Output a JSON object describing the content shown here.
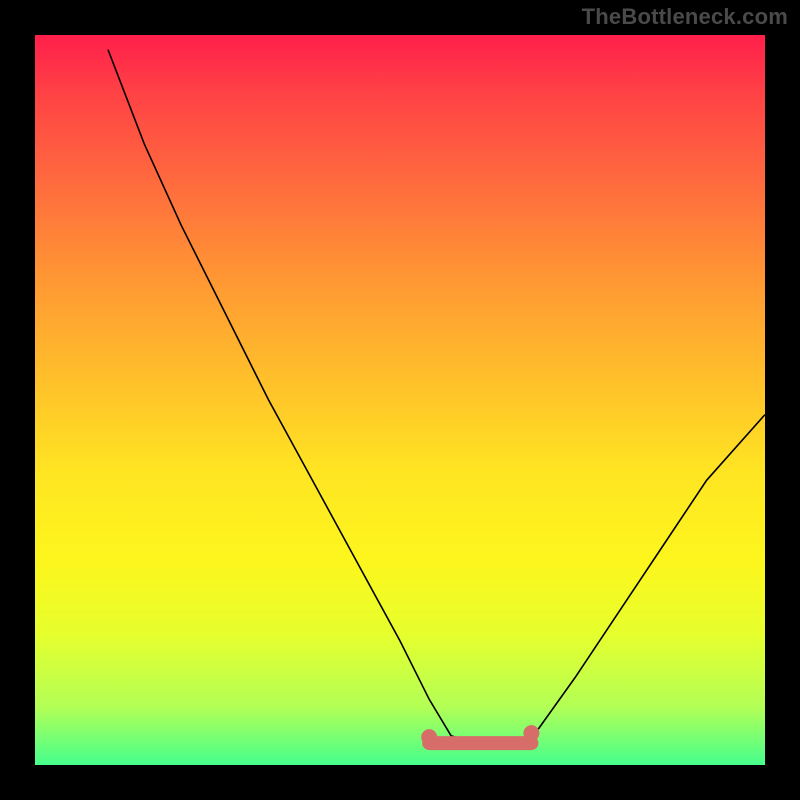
{
  "watermark": "TheBottleneck.com",
  "chart_data": {
    "type": "line",
    "title": "",
    "xlabel": "",
    "ylabel": "",
    "xlim": [
      0,
      100
    ],
    "ylim": [
      0,
      100
    ],
    "description": "V-shaped bottleneck curve over red-to-green vertical gradient; minimum plateau near x≈55–67 at y≈3, left arm rises to ~98 at x≈10, right arm rises to ~48 at x=100.",
    "series": [
      {
        "name": "bottleneck-curve",
        "x": [
          10,
          15,
          20,
          26,
          32,
          38,
          44,
          50,
          54,
          57,
          60,
          63,
          66,
          69,
          74,
          80,
          86,
          92,
          100
        ],
        "y": [
          98,
          85,
          74,
          62,
          50,
          39,
          28,
          17,
          9,
          4,
          3,
          3,
          3,
          5,
          12,
          21,
          30,
          39,
          48
        ]
      }
    ],
    "flat_region": {
      "x_start": 54,
      "x_end": 68,
      "y": 3
    },
    "colors": {
      "gradient_top": "#ff1f4b",
      "gradient_bottom": "#45ff8d",
      "curve": "#000000",
      "marker": "#d66d68"
    }
  }
}
